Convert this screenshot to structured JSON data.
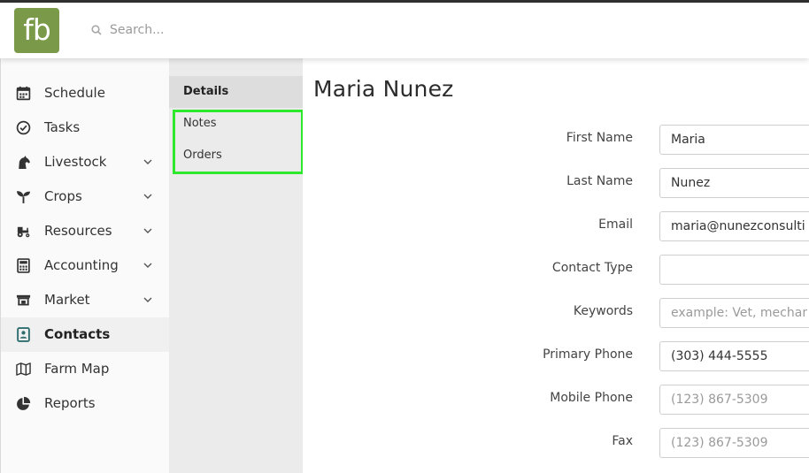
{
  "header": {
    "logo_text": "fb",
    "search_placeholder": "Search..."
  },
  "sidebar": {
    "items": [
      {
        "label": "Schedule",
        "icon": "calendar-icon",
        "expandable": false,
        "active": false
      },
      {
        "label": "Tasks",
        "icon": "check-circle-icon",
        "expandable": false,
        "active": false
      },
      {
        "label": "Livestock",
        "icon": "horse-icon",
        "expandable": true,
        "active": false
      },
      {
        "label": "Crops",
        "icon": "seedling-icon",
        "expandable": true,
        "active": false
      },
      {
        "label": "Resources",
        "icon": "tractor-icon",
        "expandable": true,
        "active": false
      },
      {
        "label": "Accounting",
        "icon": "calculator-icon",
        "expandable": true,
        "active": false
      },
      {
        "label": "Market",
        "icon": "store-icon",
        "expandable": true,
        "active": false
      },
      {
        "label": "Contacts",
        "icon": "address-book-icon",
        "expandable": false,
        "active": true
      },
      {
        "label": "Farm Map",
        "icon": "map-icon",
        "expandable": false,
        "active": false
      },
      {
        "label": "Reports",
        "icon": "pie-chart-icon",
        "expandable": false,
        "active": false
      }
    ]
  },
  "subnav": {
    "items": [
      {
        "label": "Details",
        "active": true
      },
      {
        "label": "Notes",
        "active": false
      },
      {
        "label": "Orders",
        "active": false
      }
    ],
    "highlight_color": "#2ee82e"
  },
  "main": {
    "title": "Maria Nunez",
    "fields": [
      {
        "label": "First Name",
        "value": "Maria",
        "placeholder": ""
      },
      {
        "label": "Last Name",
        "value": "Nunez",
        "placeholder": ""
      },
      {
        "label": "Email",
        "value": "maria@nunezconsulti",
        "placeholder": ""
      },
      {
        "label": "Contact Type",
        "value": "",
        "placeholder": ""
      },
      {
        "label": "Keywords",
        "value": "",
        "placeholder": "example: Vet, mechan"
      },
      {
        "label": "Primary Phone",
        "value": "(303) 444-5555",
        "placeholder": ""
      },
      {
        "label": "Mobile Phone",
        "value": "",
        "placeholder": "(123) 867-5309"
      },
      {
        "label": "Fax",
        "value": "",
        "placeholder": "(123) 867-5309"
      }
    ]
  },
  "colors": {
    "brand": "#7a9a4a",
    "sidebar_bg": "#fafafa",
    "subnav_bg": "#ebebeb"
  }
}
